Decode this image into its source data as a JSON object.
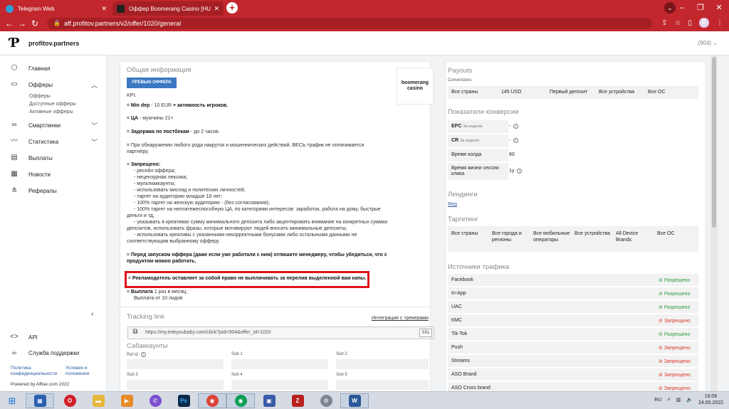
{
  "browser": {
    "tabs": [
      {
        "title": "Telegram Web",
        "icon_color": "#2b9fd9"
      },
      {
        "title": "Оффер Boomerang Casino [HU]",
        "icon_color": "#222222"
      }
    ],
    "url": "aff.profitov.partners/v2/offer/1020/general",
    "profile_initial": "B"
  },
  "header": {
    "brand": "profitov.partners",
    "balance": "(904)"
  },
  "sidebar": {
    "items": [
      {
        "label": "Главная",
        "icon": "cube-icon"
      },
      {
        "label": "Офферы",
        "icon": "bookmark-icon"
      },
      {
        "label": "Смартлинки",
        "icon": "link-icon"
      },
      {
        "label": "Статистика",
        "icon": "chart-icon"
      },
      {
        "label": "Выплаты",
        "icon": "wallet-icon"
      },
      {
        "label": "Новости",
        "icon": "news-icon"
      },
      {
        "label": "Рефералы",
        "icon": "share-icon"
      }
    ],
    "offer_subitems": [
      "Офферы",
      "Доступные офферы",
      "Активные офферы"
    ],
    "api": "API",
    "support": "Служба поддержки",
    "privacy": "Политика конфиденциальности",
    "terms": "Условия и положения",
    "powered": "Powered by Affise.com 2022"
  },
  "offer": {
    "section_title": "Общая информация",
    "preview_button": "ПРЕВЬЮ ОФФЕРА",
    "logo_text": "boomerang casino",
    "kpi_title": "KPI:",
    "lines": {
      "min_dep_label": "Min dep",
      "min_dep_value": " - 10 EUR",
      "min_dep_extra": " + активность игроков.",
      "ca_label": "ЦА",
      "ca_value": " - мужчины 21+",
      "delay_label": "Задержка по постбекам",
      "delay_value": " - до 2 часов.",
      "fraud": "При обнаружении любого рода накруток и мошеннических действий, ВЕСЬ трафик не оплачивается партнёру.",
      "forbidden_label": "Запрещено:",
      "forbidden": [
        "- ресейл оффера;",
        "- нецензурная лексика;",
        "- мультиаккаунты;",
        "- использовать мислид и политеских личностей;",
        "- таргет на аудиторию младше 18 лет;",
        "- 100% таргет на женскую аудиторию - (без согласования);",
        "- 100% таргет на неплатежеспособную ЦА, по категориям интересов: заработок, работа на дому, быстрые деньги и тд;",
        "- указывать в креативах сумму минимального депозита либо акцентировать внимание на конкретных суммах депозитов, использовать фразы, которые мотивируют людей вносить минимальные депозиты;",
        "- использовать креативы с указанными некорректными бонусами либо остальными данными не соответствующим выбранному офферу."
      ],
      "before_launch": "Перед запуском оффера (даже если уже работали с ним) отпишите менеджеру, чтобы убедиться, что с продуктом можно работать.",
      "cap_warning": "Рекламодатель оставляет за собой право не выплачивать за перелив выделенной вам капы.",
      "payout_label": "Выплата",
      "payout_value": " 1 раз в месяц;",
      "payout_extra": "Выплата от 10 лидов"
    },
    "tracking_title": "Tracking link",
    "integration_link": "Интеграция с трекерами",
    "tracking_url": "https://my.trekyoubaby.com/click?pid=904&offer_id=1020",
    "ssl": "SSL",
    "subaccounts_title": "Сабаккаунты",
    "subs": [
      "Ref id",
      "Sub 1",
      "Sub 2",
      "Sub 3",
      "Sub 4",
      "Sub 5"
    ]
  },
  "payouts": {
    "title": "Payouts",
    "conversions": "Conversions",
    "row": {
      "country": "Все страны",
      "amount": "145 USD",
      "type": "Первый депозит",
      "device": "Все устройства",
      "os": "Все ОС"
    }
  },
  "conversion": {
    "title": "Показатели конверсии",
    "rows": [
      {
        "label": "EPC",
        "note": "За неделю",
        "value": "-"
      },
      {
        "label": "CR",
        "note": "За неделю",
        "value": "-"
      },
      {
        "label": "Время холда",
        "note": "",
        "value": "60"
      },
      {
        "label": "Время жизни сессии клика",
        "note": "",
        "value": "1y"
      }
    ]
  },
  "landings": {
    "title": "Лендинги",
    "item": "Reg"
  },
  "targeting": {
    "title": "Таргетинг",
    "cols": [
      "Все страны",
      "Все города и регионы",
      "Все мобильные операторы",
      "Все устройства",
      "All Device Brands",
      "Все ОС"
    ]
  },
  "traffic": {
    "title": "Источники трафика",
    "rows": [
      {
        "name": "Facebook",
        "status": "Разрешено",
        "ok": true
      },
      {
        "name": "In-App",
        "status": "Разрешено",
        "ok": true
      },
      {
        "name": "UAC",
        "status": "Разрешено",
        "ok": true
      },
      {
        "name": "КМС",
        "status": "Запрещено",
        "ok": false
      },
      {
        "name": "Tik-Tok",
        "status": "Разрешено",
        "ok": true
      },
      {
        "name": "Push",
        "status": "Запрещено",
        "ok": false
      },
      {
        "name": "Streams",
        "status": "Запрещено",
        "ok": false
      },
      {
        "name": "ASO Brand",
        "status": "Запрещено",
        "ok": false
      },
      {
        "name": "ASO Cross brand",
        "status": "Запрещено",
        "ok": false
      }
    ]
  },
  "taskbar": {
    "lang": "RU",
    "time": "16:06",
    "date": "24.05.2022"
  }
}
